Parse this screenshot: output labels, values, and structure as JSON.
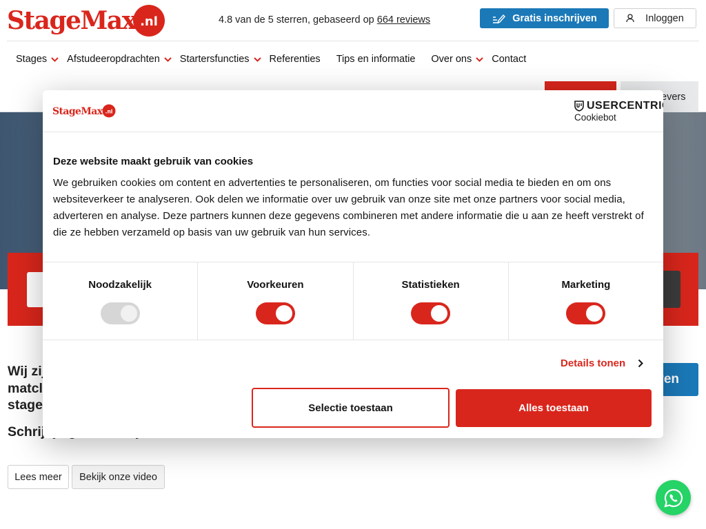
{
  "header": {
    "logo_text": "StageMax.nl",
    "rating_prefix": "4.8 van de 5 sterren, gebaseerd op ",
    "rating_link": "664 reviews",
    "signup_label": "Gratis inschrijven",
    "login_label": "Inloggen"
  },
  "nav": {
    "items": [
      {
        "label": "Stages",
        "dropdown": true
      },
      {
        "label": "Afstudeeropdrachten",
        "dropdown": true
      },
      {
        "label": "Startersfuncties",
        "dropdown": true
      },
      {
        "label": "Referenties",
        "dropdown": false
      },
      {
        "label": "Tips en informatie",
        "dropdown": false
      },
      {
        "label": "Over ons",
        "dropdown": true
      },
      {
        "label": "Contact",
        "dropdown": false
      }
    ]
  },
  "background": {
    "gray_tab_label": "evers",
    "heading": "Wij zij\nmatcl\nstage",
    "subheading": "Schrijf je gratis in bij",
    "cta_label": "ven",
    "lees_meer": "Lees meer",
    "video_button": "Bekijk onze video"
  },
  "cookie_dialog": {
    "brand": "USERCENTRICS",
    "brand_sub": "Cookiebot",
    "title": "Deze website maakt gebruik van cookies",
    "body": "We gebruiken cookies om content en advertenties te personaliseren, om functies voor social media te bieden en om ons websiteverkeer te analyseren. Ook delen we informatie over uw gebruik van onze site met onze partners voor social media, adverteren en analyse. Deze partners kunnen deze gegevens combineren met andere informatie die u aan ze heeft verstrekt of die ze hebben verzameld op basis van uw gebruik van hun services.",
    "toggles": [
      {
        "label": "Noodzakelijk",
        "on": true,
        "disabled": true
      },
      {
        "label": "Voorkeuren",
        "on": true,
        "disabled": false
      },
      {
        "label": "Statistieken",
        "on": true,
        "disabled": false
      },
      {
        "label": "Marketing",
        "on": true,
        "disabled": false
      }
    ],
    "details_label": "Details tonen",
    "select_label": "Selectie toestaan",
    "allow_all_label": "Alles toestaan"
  },
  "colors": {
    "brand_red": "#d9261c",
    "brand_blue": "#1b79b8",
    "whatsapp_green": "#25d366"
  },
  "icons": [
    "pencil-icon",
    "user-icon",
    "chevron-down-icon",
    "chevron-right-icon",
    "whatsapp-icon",
    "usercentrics-shield-icon"
  ]
}
